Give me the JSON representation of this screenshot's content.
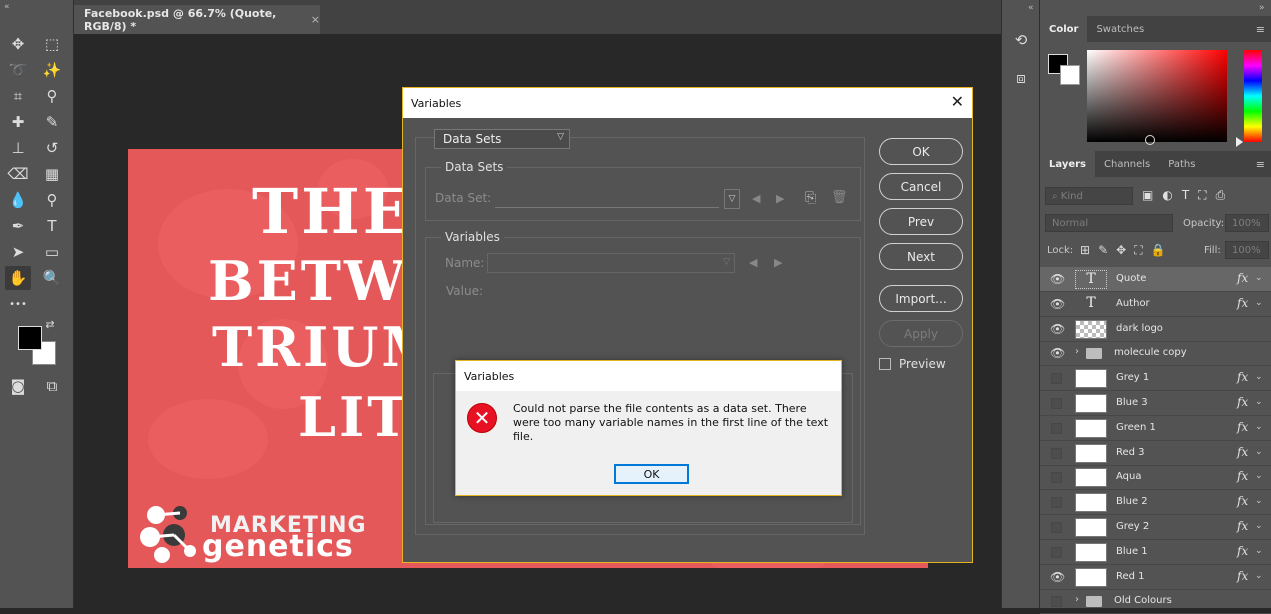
{
  "document": {
    "tab_title": "Facebook.psd @ 66.7% (Quote, RGB/8) *",
    "close_glyph": "×"
  },
  "artwork": {
    "headline_lines": [
      "THE",
      "BETWE",
      "TRIUM",
      "LIT"
    ],
    "logo_marketing": "MARKETING",
    "logo_genetics": "genetics"
  },
  "toolbar": {
    "collapse_glyph": "«",
    "tools": [
      {
        "name": "move-tool-icon",
        "glyph": "✥"
      },
      {
        "name": "marquee-tool-icon",
        "glyph": "⬚"
      },
      {
        "name": "lasso-tool-icon",
        "glyph": "➰"
      },
      {
        "name": "magic-wand-tool-icon",
        "glyph": "✨"
      },
      {
        "name": "crop-tool-icon",
        "glyph": "⌗"
      },
      {
        "name": "eyedropper-tool-icon",
        "glyph": "⚲"
      },
      {
        "name": "healing-brush-tool-icon",
        "glyph": "✚"
      },
      {
        "name": "brush-tool-icon",
        "glyph": "✎"
      },
      {
        "name": "clone-stamp-tool-icon",
        "glyph": "⊥"
      },
      {
        "name": "history-brush-tool-icon",
        "glyph": "↺"
      },
      {
        "name": "eraser-tool-icon",
        "glyph": "⌫"
      },
      {
        "name": "gradient-tool-icon",
        "glyph": "▦"
      },
      {
        "name": "blur-tool-icon",
        "glyph": "💧"
      },
      {
        "name": "dodge-tool-icon",
        "glyph": "⚲"
      },
      {
        "name": "pen-tool-icon",
        "glyph": "✒"
      },
      {
        "name": "type-tool-icon",
        "glyph": "T"
      },
      {
        "name": "path-selection-tool-icon",
        "glyph": "➤"
      },
      {
        "name": "rectangle-tool-icon",
        "glyph": "▭"
      },
      {
        "name": "hand-tool-icon",
        "glyph": "✋"
      },
      {
        "name": "zoom-tool-icon",
        "glyph": "🔍"
      },
      {
        "name": "edit-toolbar-icon",
        "glyph": "•••"
      },
      {
        "name": "swap-colors-icon",
        "glyph": "⇄"
      },
      {
        "name": "quick-mask-icon",
        "glyph": "◙"
      },
      {
        "name": "screen-mode-icon",
        "glyph": "⧉"
      }
    ]
  },
  "mid_panel": {
    "collapse_glyph": "«",
    "history_icon_glyph": "⟲",
    "properties_icon_glyph": "⧈"
  },
  "color_panel": {
    "collapse_glyph": "»",
    "tabs": [
      "Color",
      "Swatches"
    ],
    "active_tab": "Color",
    "menu_glyph": "≡",
    "foreground": "#000000",
    "background": "#ffffff"
  },
  "layers_panel": {
    "tabs": [
      "Layers",
      "Channels",
      "Paths"
    ],
    "active_tab": "Layers",
    "menu_glyph": "≡",
    "filter_label": "Kind",
    "filter_glyph": "⌕",
    "filter_icons": [
      "▣",
      "◐",
      "T",
      "⛶",
      "⎙"
    ],
    "blend_mode": "Normal",
    "opacity_label": "Opacity:",
    "opacity_value": "100%",
    "lock_label": "Lock:",
    "lock_icons": [
      "⊞",
      "✎",
      "✥",
      "⛶",
      "🔒"
    ],
    "fill_label": "Fill:",
    "fill_value": "100%",
    "layers": [
      {
        "name": "Quote",
        "type": "text",
        "visible": true,
        "fx": true,
        "selected": true
      },
      {
        "name": "Author",
        "type": "text",
        "visible": true,
        "fx": true,
        "selected": false
      },
      {
        "name": "dark logo",
        "type": "smart",
        "visible": true,
        "fx": false,
        "selected": false
      },
      {
        "name": "molecule copy",
        "type": "group",
        "visible": true,
        "fx": false,
        "selected": false
      },
      {
        "name": "Grey 1",
        "type": "fill",
        "visible": false,
        "fx": true,
        "selected": false
      },
      {
        "name": "Blue 3",
        "type": "fill",
        "visible": false,
        "fx": true,
        "selected": false
      },
      {
        "name": "Green 1",
        "type": "fill",
        "visible": false,
        "fx": true,
        "selected": false
      },
      {
        "name": "Red 3",
        "type": "fill",
        "visible": false,
        "fx": true,
        "selected": false
      },
      {
        "name": "Aqua",
        "type": "fill",
        "visible": false,
        "fx": true,
        "selected": false
      },
      {
        "name": "Blue 2",
        "type": "fill",
        "visible": false,
        "fx": true,
        "selected": false
      },
      {
        "name": "Grey 2",
        "type": "fill",
        "visible": false,
        "fx": true,
        "selected": false
      },
      {
        "name": "Blue 1",
        "type": "fill",
        "visible": false,
        "fx": true,
        "selected": false
      },
      {
        "name": "Red 1",
        "type": "fill",
        "visible": true,
        "fx": true,
        "selected": false
      },
      {
        "name": "Old Colours",
        "type": "group",
        "visible": false,
        "fx": false,
        "selected": false
      }
    ]
  },
  "variables_dialog": {
    "title": "Variables",
    "close_glyph": "✕",
    "mode_select": "Data Sets",
    "data_sets_group": "Data Sets",
    "data_set_label": "Data Set:",
    "variables_group": "Variables",
    "name_label": "Name:",
    "value_label": "Value:",
    "buttons": {
      "ok": "OK",
      "cancel": "Cancel",
      "prev": "Prev",
      "next": "Next",
      "import": "Import...",
      "apply": "Apply"
    },
    "preview_label": "Preview"
  },
  "error_dialog": {
    "title": "Variables",
    "icon_glyph": "✕",
    "message": "Could not parse the file contents as a data set. There were too many variable names in the first line of the text file.",
    "ok_label": "OK"
  }
}
